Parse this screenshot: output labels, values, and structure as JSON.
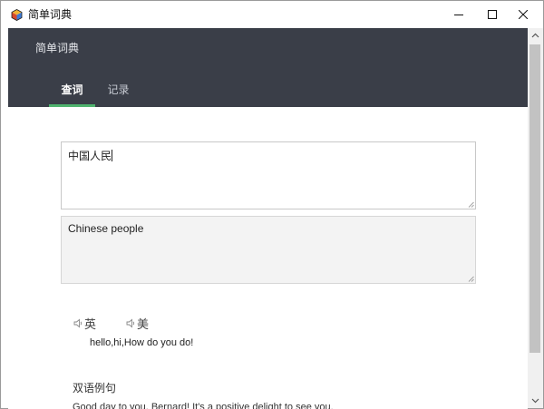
{
  "window": {
    "title": "简单词典",
    "icon": "dictionary-cube-icon",
    "controls": [
      "minimize-icon",
      "maximize-icon",
      "close-icon"
    ]
  },
  "header": {
    "title": "简单词典",
    "background": "#3a3e48",
    "accent": "#4fb36e"
  },
  "tabs": [
    {
      "label": "查词",
      "active": true
    },
    {
      "label": "记录",
      "active": false
    }
  ],
  "lookup": {
    "input_value": "中国人民",
    "translation": "Chinese people"
  },
  "phonetics": [
    {
      "label": "英",
      "icon": "speaker-icon"
    },
    {
      "label": "美",
      "icon": "speaker-icon"
    }
  ],
  "definition": "hello,hi,How do you do!",
  "examples": {
    "title": "双语例句",
    "first_sentence": "Good day to you, Bernard! It's a positive delight to see you."
  }
}
